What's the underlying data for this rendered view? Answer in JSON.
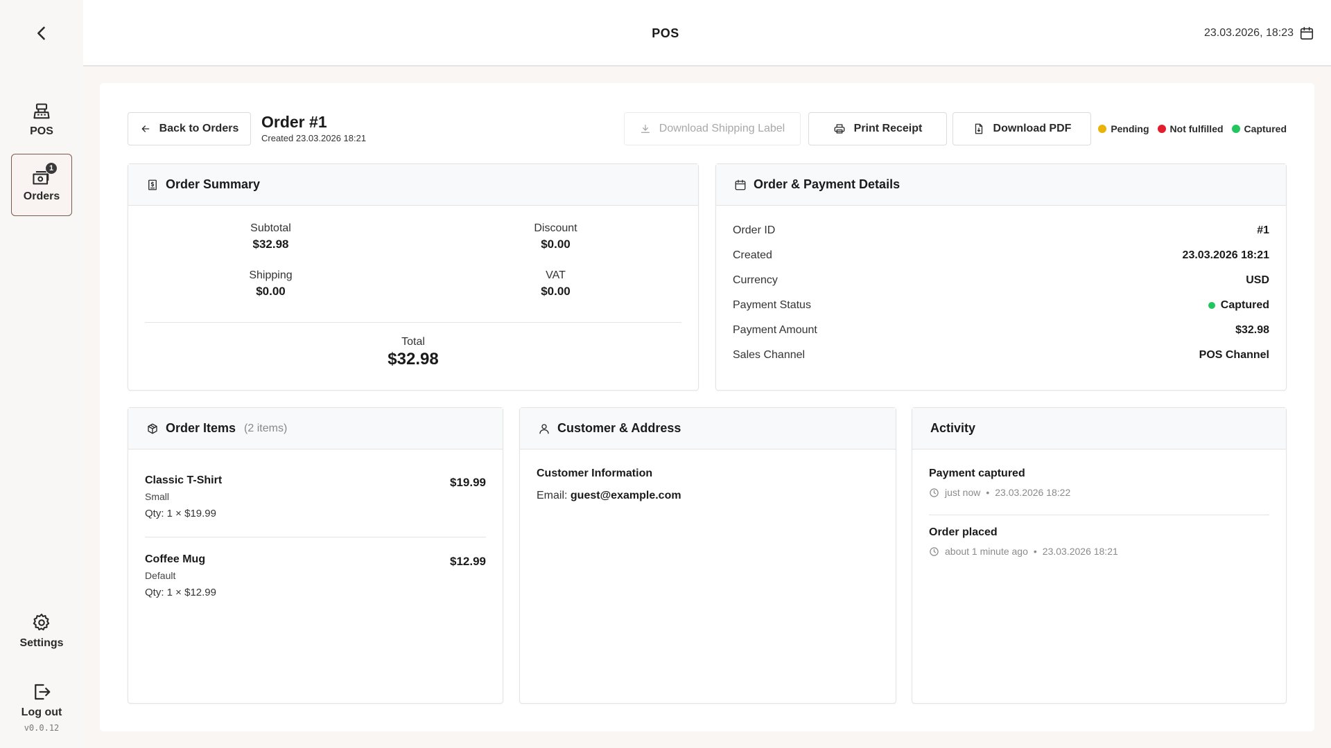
{
  "topbar": {
    "title": "POS",
    "datetime": "23.03.2026, 18:23",
    "icons": {
      "back": "chevron-left-icon",
      "calendar": "calendar-icon"
    }
  },
  "sidebar": {
    "items": [
      {
        "label": "POS",
        "icon": "register-icon"
      },
      {
        "label": "Orders",
        "icon": "orders-icon",
        "badge": "1",
        "active": true
      },
      {
        "label": "Settings",
        "icon": "gear-icon"
      },
      {
        "label": "Log out",
        "icon": "logout-icon"
      }
    ],
    "version": "v0.0.12"
  },
  "order": {
    "back_label": "Back to Orders",
    "title": "Order #1",
    "created": "Created 23.03.2026 18:21",
    "actions": {
      "shipping_label": "Download Shipping Label",
      "print_receipt": "Print Receipt",
      "download_pdf": "Download PDF"
    },
    "statuses": [
      {
        "label": "Pending",
        "color": "#eab308"
      },
      {
        "label": "Not fulfilled",
        "color": "#e11d2e"
      },
      {
        "label": "Captured",
        "color": "#22c55e"
      }
    ]
  },
  "summary": {
    "title": "Order Summary",
    "subtotal_label": "Subtotal",
    "subtotal": "$32.98",
    "discount_label": "Discount",
    "discount": "$0.00",
    "shipping_label": "Shipping",
    "shipping": "$0.00",
    "vat_label": "VAT",
    "vat": "$0.00",
    "total_label": "Total",
    "total": "$32.98"
  },
  "details": {
    "title": "Order & Payment Details",
    "rows": [
      {
        "key": "Order ID",
        "value": "#1"
      },
      {
        "key": "Created",
        "value": "23.03.2026 18:21"
      },
      {
        "key": "Currency",
        "value": "USD"
      },
      {
        "key": "Payment Status",
        "value": "Captured",
        "color": "#22c55e"
      },
      {
        "key": "Payment Amount",
        "value": "$32.98"
      },
      {
        "key": "Sales Channel",
        "value": "POS Channel"
      }
    ]
  },
  "items": {
    "title": "Order Items",
    "count": "(2 items)",
    "list": [
      {
        "name": "Classic T-Shirt",
        "variant": "Small",
        "qty": "Qty: 1 × $19.99",
        "price": "$19.99"
      },
      {
        "name": "Coffee Mug",
        "variant": "Default",
        "qty": "Qty: 1 × $12.99",
        "price": "$12.99"
      }
    ]
  },
  "customer": {
    "title": "Customer & Address",
    "section_label": "Customer Information",
    "email_label": "Email:",
    "email": "guest@example.com"
  },
  "activity": {
    "title": "Activity",
    "events": [
      {
        "title": "Payment captured",
        "relative": "just now",
        "time": "23.03.2026 18:22"
      },
      {
        "title": "Order placed",
        "relative": "about 1 minute ago",
        "time": "23.03.2026 18:21"
      }
    ],
    "separator": "•"
  }
}
